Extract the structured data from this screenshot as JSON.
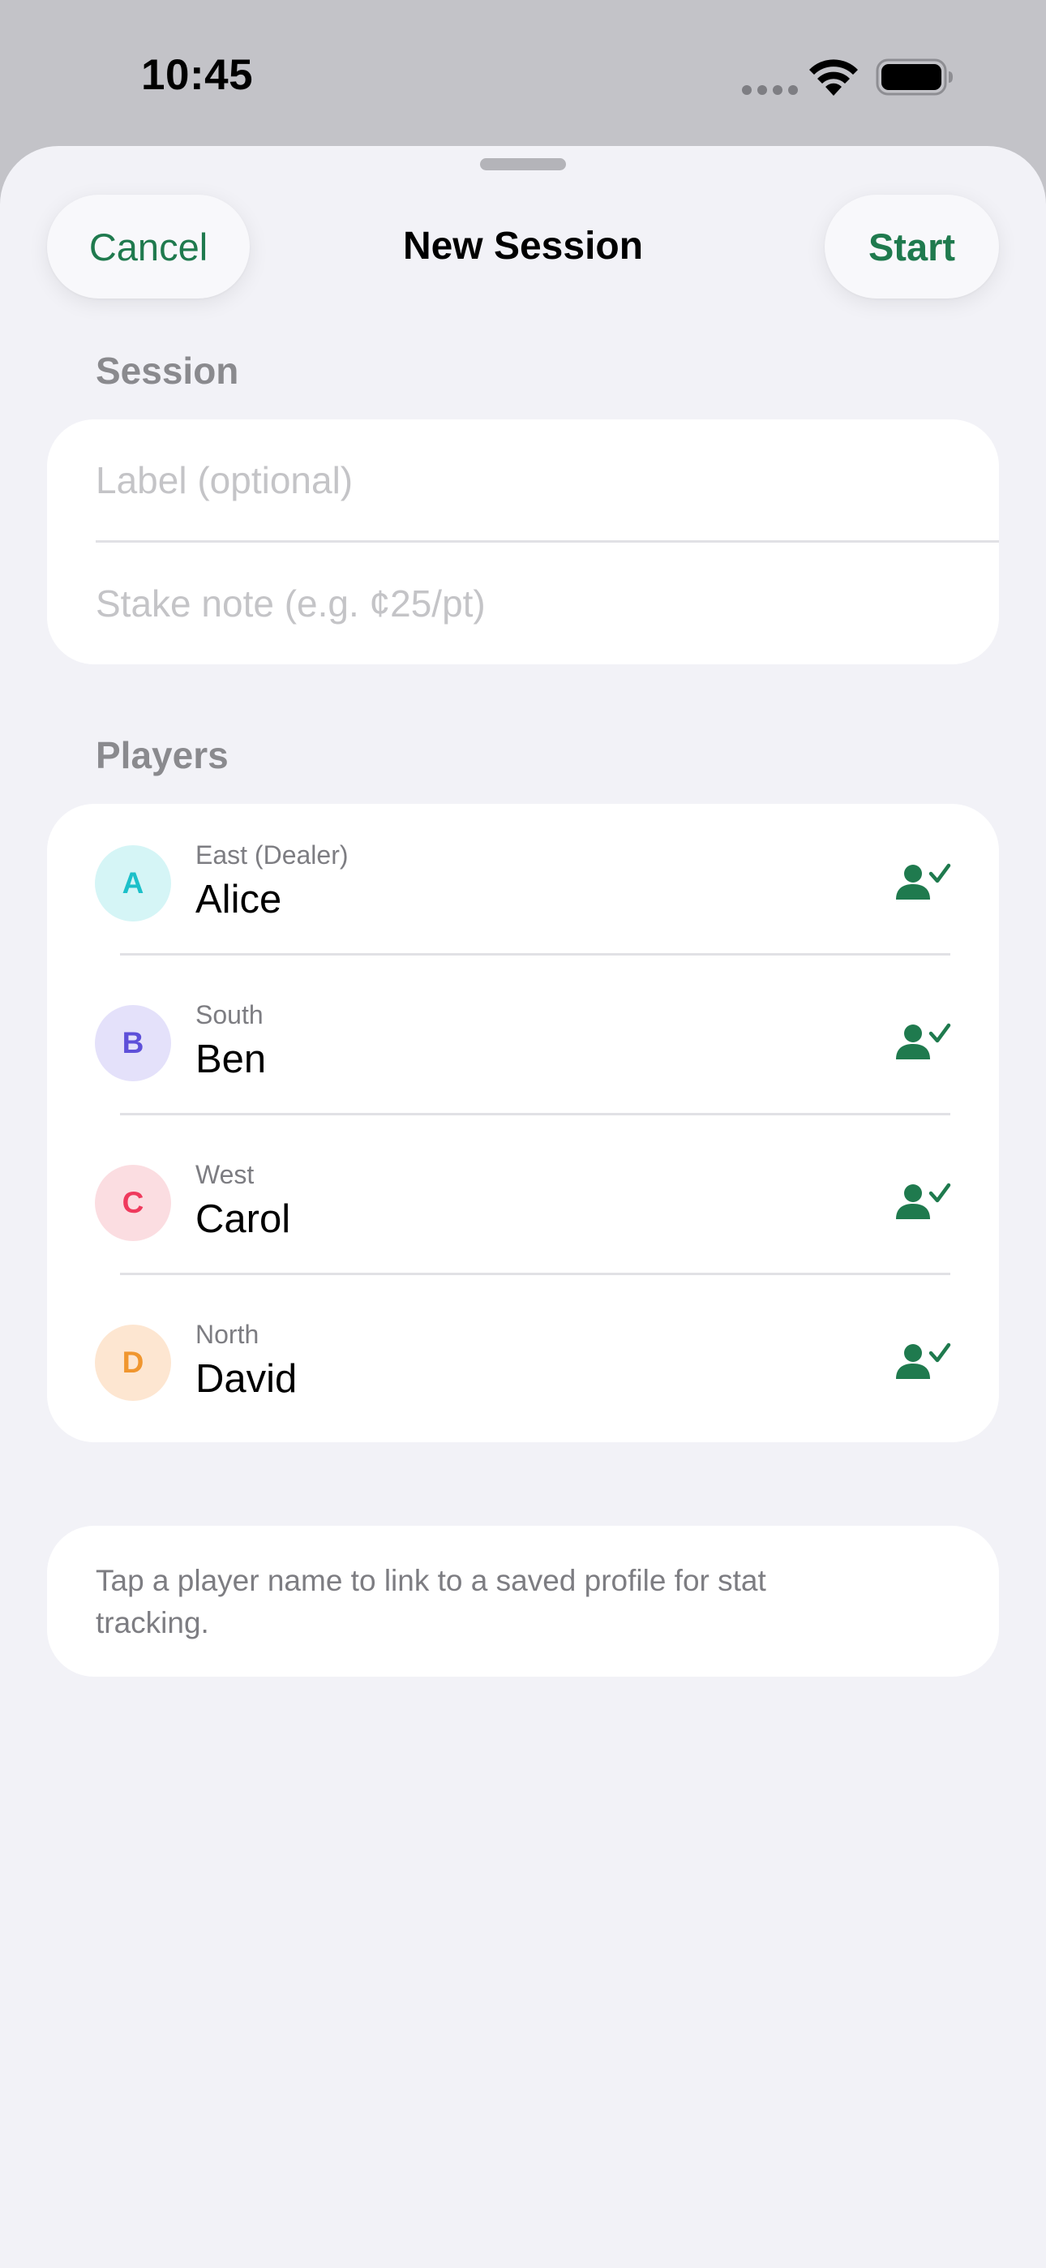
{
  "status_bar": {
    "time": "10:45",
    "icons": [
      "cellular-dots-icon",
      "wifi-icon",
      "battery-icon"
    ]
  },
  "nav": {
    "title": "New Session",
    "cancel_label": "Cancel",
    "start_label": "Start"
  },
  "session": {
    "header": "Session",
    "label_placeholder": "Label (optional)",
    "stake_placeholder": "Stake note (e.g. ¢25/pt)"
  },
  "players": {
    "header": "Players",
    "items": [
      {
        "initial": "A",
        "seat": "East (Dealer)",
        "name": "Alice",
        "avatar_bg": "#d5f5f6",
        "avatar_fg": "#1cc0c9"
      },
      {
        "initial": "B",
        "seat": "South",
        "name": "Ben",
        "avatar_bg": "#e4e1fa",
        "avatar_fg": "#5e50d9"
      },
      {
        "initial": "C",
        "seat": "West",
        "name": "Carol",
        "avatar_bg": "#fbdde1",
        "avatar_fg": "#ef3a5d"
      },
      {
        "initial": "D",
        "seat": "North",
        "name": "David",
        "avatar_bg": "#fde6d1",
        "avatar_fg": "#f0962f"
      }
    ],
    "link_icon": "person-checkmark-icon"
  },
  "footnote": "Tap a player name to link to a saved profile for stat tracking.",
  "colors": {
    "accent": "#1f7a4e",
    "background": "#f2f2f7",
    "card": "#ffffff",
    "secondary_text": "#8a8a8e"
  }
}
